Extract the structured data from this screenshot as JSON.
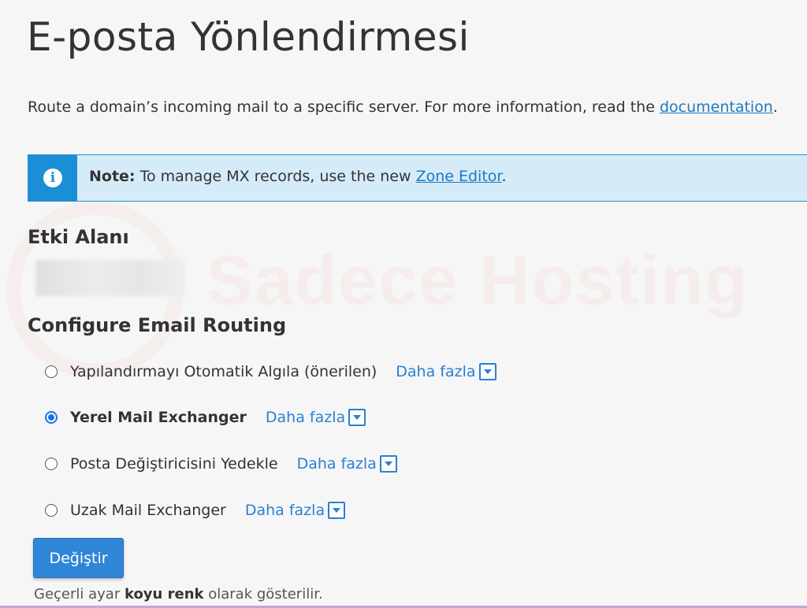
{
  "watermark": {
    "text": "Sadece Hosting"
  },
  "page": {
    "title": "E-posta Yönlendirmesi",
    "description_before": "Route a domain’s incoming mail to a specific server. For more information, read the ",
    "description_link": "documentation",
    "description_after": "."
  },
  "alert": {
    "icon": "info-icon",
    "icon_glyph": "i",
    "note_label": "Note:",
    "text_before": " To manage MX records, use the new ",
    "link": "Zone Editor",
    "text_after": "."
  },
  "domain_section": {
    "heading": "Etki Alanı"
  },
  "routing": {
    "heading": "Configure Email Routing",
    "options": [
      {
        "label": "Yapılandırmayı Otomatik Algıla (önerilen)",
        "checked": false,
        "more": "Daha fazla"
      },
      {
        "label": "Yerel Mail Exchanger",
        "checked": true,
        "more": "Daha fazla"
      },
      {
        "label": "Posta Değiştiricisini Yedekle",
        "checked": false,
        "more": "Daha fazla"
      },
      {
        "label": "Uzak Mail Exchanger",
        "checked": false,
        "more": "Daha fazla"
      }
    ],
    "submit_label": "Değiştir",
    "footnote_before": "Geçerli ayar ",
    "footnote_bold": "koyu renk",
    "footnote_after": " olarak gösterilir."
  },
  "colors": {
    "accent": "#2f86d6",
    "link": "#1b7ac2",
    "alert_bg": "#d6ebf8",
    "alert_icon_bg": "#1b8fd6"
  }
}
